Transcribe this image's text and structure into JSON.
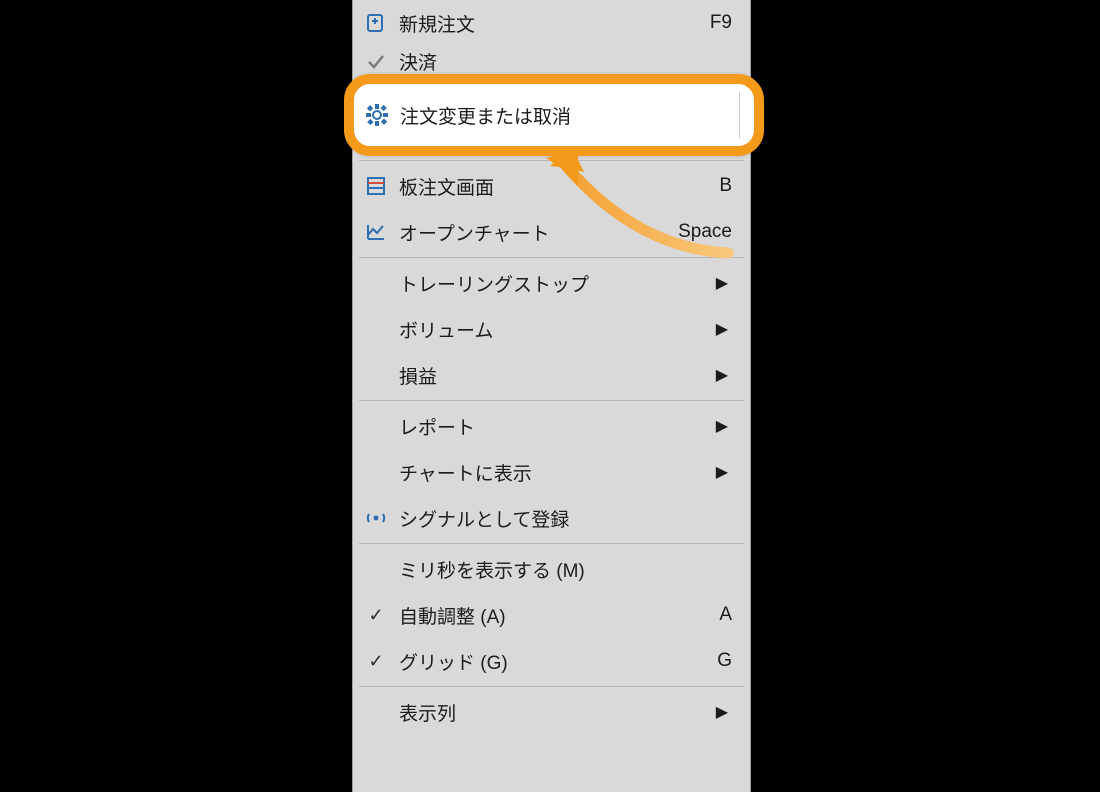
{
  "menu": {
    "items": [
      {
        "label": "新規注文",
        "shortcut": "F9",
        "icon": "new-order-icon"
      },
      {
        "label": "決済",
        "shortcut": "",
        "icon": "close-position-icon"
      },
      {
        "label": "注文変更または取消",
        "shortcut": "",
        "icon": "gear-icon",
        "highlighted": true
      },
      {
        "type": "sep"
      },
      {
        "label": "板注文画面",
        "shortcut": "B",
        "icon": "depth-of-market-icon"
      },
      {
        "label": "オープンチャート",
        "shortcut": "Space",
        "icon": "chart-icon"
      },
      {
        "type": "sep"
      },
      {
        "label": "トレーリングストップ",
        "submenu": true
      },
      {
        "label": "ボリューム",
        "submenu": true
      },
      {
        "label": "損益",
        "submenu": true
      },
      {
        "type": "sep"
      },
      {
        "label": "レポート",
        "submenu": true
      },
      {
        "label": "チャートに表示",
        "submenu": true
      },
      {
        "label": "シグナルとして登録",
        "icon": "signal-icon"
      },
      {
        "type": "sep"
      },
      {
        "label": "ミリ秒を表示する (M)"
      },
      {
        "label": "自動調整 (A)",
        "shortcut": "A",
        "icon": "check-icon"
      },
      {
        "label": "グリッド (G)",
        "shortcut": "G",
        "icon": "check-icon"
      },
      {
        "type": "sep"
      },
      {
        "label": "表示列",
        "submenu": true
      }
    ]
  },
  "colors": {
    "callout_border": "#f49a1a",
    "menu_bg": "#d9d9d9"
  }
}
